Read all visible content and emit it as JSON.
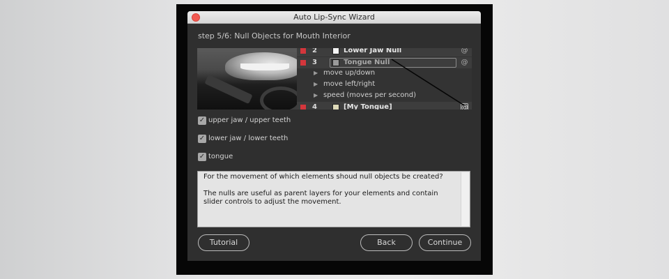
{
  "window": {
    "title": "Auto Lip-Sync Wizard",
    "step": "step 5/6: Null Objects for Mouth Interior"
  },
  "layers": [
    {
      "num": "2",
      "name": "Lower Jaw Null",
      "swatch": "#f4f4f4"
    },
    {
      "num": "3",
      "name": "Tongue Null",
      "swatch": "#9a9a9a"
    },
    {
      "prop": "move up/down"
    },
    {
      "prop": "move left/right"
    },
    {
      "prop": "speed (moves per second)"
    },
    {
      "num": "4",
      "name": "[My Tongue]",
      "swatch": "#ddd9b8"
    }
  ],
  "options": [
    {
      "label": "upper jaw / upper teeth",
      "checked": true
    },
    {
      "label": "lower jaw / lower teeth",
      "checked": true
    },
    {
      "label": "tongue",
      "checked": true
    }
  ],
  "description": {
    "line1": "For the movement of which elements shoud null objects be created?",
    "line2": "The nulls are useful as parent layers for your elements and contain slider controls to adjust the movement."
  },
  "buttons": {
    "tutorial": "Tutorial",
    "back": "Back",
    "continue": "Continue"
  },
  "icons": {
    "checkmark": "✓",
    "spiral": "@",
    "expand": "▶"
  },
  "colors": {
    "label_red": "#d4363c",
    "close_red": "#f25a52",
    "window_bg": "#2f2f2f"
  }
}
